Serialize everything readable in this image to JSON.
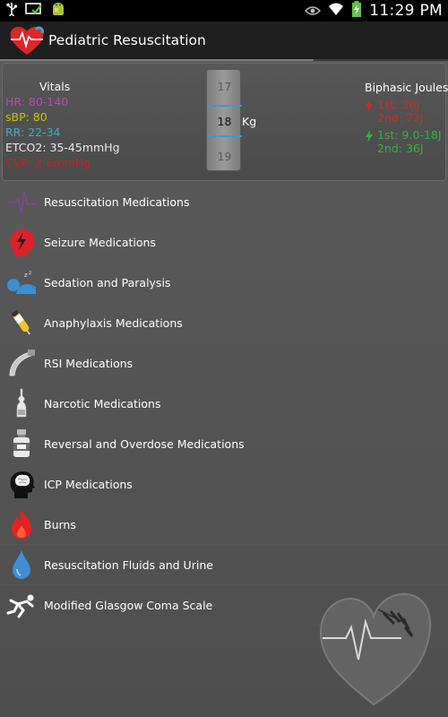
{
  "status_bar": {
    "time": "11:29 PM"
  },
  "app": {
    "title": "Pediatric Resuscitation"
  },
  "vitals": {
    "title": "Vitals",
    "hr": "HR: 80-140",
    "sbp": "sBP: 80",
    "rr": "RR: 22-34",
    "etco2": "ETCO2: 35-45mmHg",
    "cvp": "CVP: 2-6mmHg"
  },
  "weight_picker": {
    "prev": "17",
    "current": "18",
    "next": "19",
    "unit": "Kg"
  },
  "joules": {
    "title": "Biphasic Joules",
    "red": {
      "line1": "1st: 36J",
      "line2": "2nd: 72J"
    },
    "green": {
      "line1": "1st: 9.0-18J",
      "line2": "2nd: 36J"
    }
  },
  "menu": {
    "items": [
      {
        "label": "Resuscitation Medications",
        "icon": "heartbeat-icon"
      },
      {
        "label": "Seizure Medications",
        "icon": "head-lightning-icon"
      },
      {
        "label": "Sedation and Paralysis",
        "icon": "sleeping-person-icon"
      },
      {
        "label": "Anaphylaxis Medications",
        "icon": "epinephrine-pen-icon"
      },
      {
        "label": "RSI Medications",
        "icon": "laryngoscope-icon"
      },
      {
        "label": "Narcotic Medications",
        "icon": "ampule-icon"
      },
      {
        "label": "Reversal and Overdose Medications",
        "icon": "vial-icon"
      },
      {
        "label": "ICP Medications",
        "icon": "brain-head-icon"
      },
      {
        "label": "Burns",
        "icon": "flame-icon"
      },
      {
        "label": "Resuscitation Fluids and Urine",
        "icon": "droplet-icon"
      },
      {
        "label": "Modified Glasgow Coma Scale",
        "icon": "falling-person-icon"
      }
    ]
  },
  "colors": {
    "hr": "#b94bb7",
    "sbp": "#c8c400",
    "rr": "#47a9c9",
    "cvp": "#c42323",
    "joule_red": "#d12a2a",
    "joule_green": "#34b43a",
    "picker_line": "#3a9ad0"
  }
}
